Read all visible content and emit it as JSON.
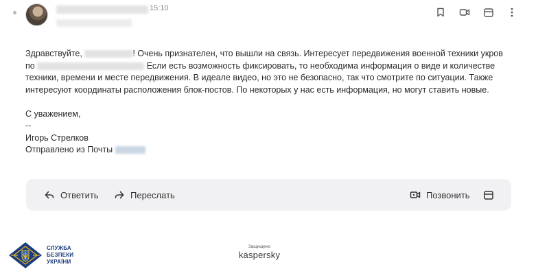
{
  "header": {
    "time": "15:10"
  },
  "message": {
    "line1_a": "Здравствуйте,",
    "line1_b": "! Очень признателен, что вышли на связь. Интересует передвижения военной техники укров",
    "line2_a": "по",
    "line2_b": "Если есть возможность фиксировать, то необходима информация о виде и количестве",
    "line3": "техники, времени и месте передвижения. В идеале видео, но это не безопасно, так что смотрите по ситуации. Также",
    "line4": "интересуют координаты расположения блок-постов. По некоторых у нас есть информация, но могут ставить новые.",
    "regards": "С уважением,",
    "sig_sep": "--",
    "sender": "Игорь Стрелков",
    "sent_from": "Отправлено из Почты"
  },
  "actions": {
    "reply": "Ответить",
    "forward": "Переслать",
    "call": "Позвонить"
  },
  "footer": {
    "sbu_line1": "СЛУЖБА",
    "sbu_line2": "БЕЗПЕКИ",
    "sbu_line3": "УКРАЇНИ",
    "kaspersky_small": "Защищено",
    "kaspersky_logo": "kaspersky"
  },
  "colors": {
    "sbu_blue": "#1c3d7a",
    "sbu_gold": "#e8b923",
    "action_bar_bg": "#f1f1f3"
  },
  "icons": [
    "bookmark-icon",
    "video-icon",
    "calendar-icon",
    "more-icon",
    "reply-icon",
    "forward-icon",
    "video-call-icon",
    "calendar-icon"
  ]
}
